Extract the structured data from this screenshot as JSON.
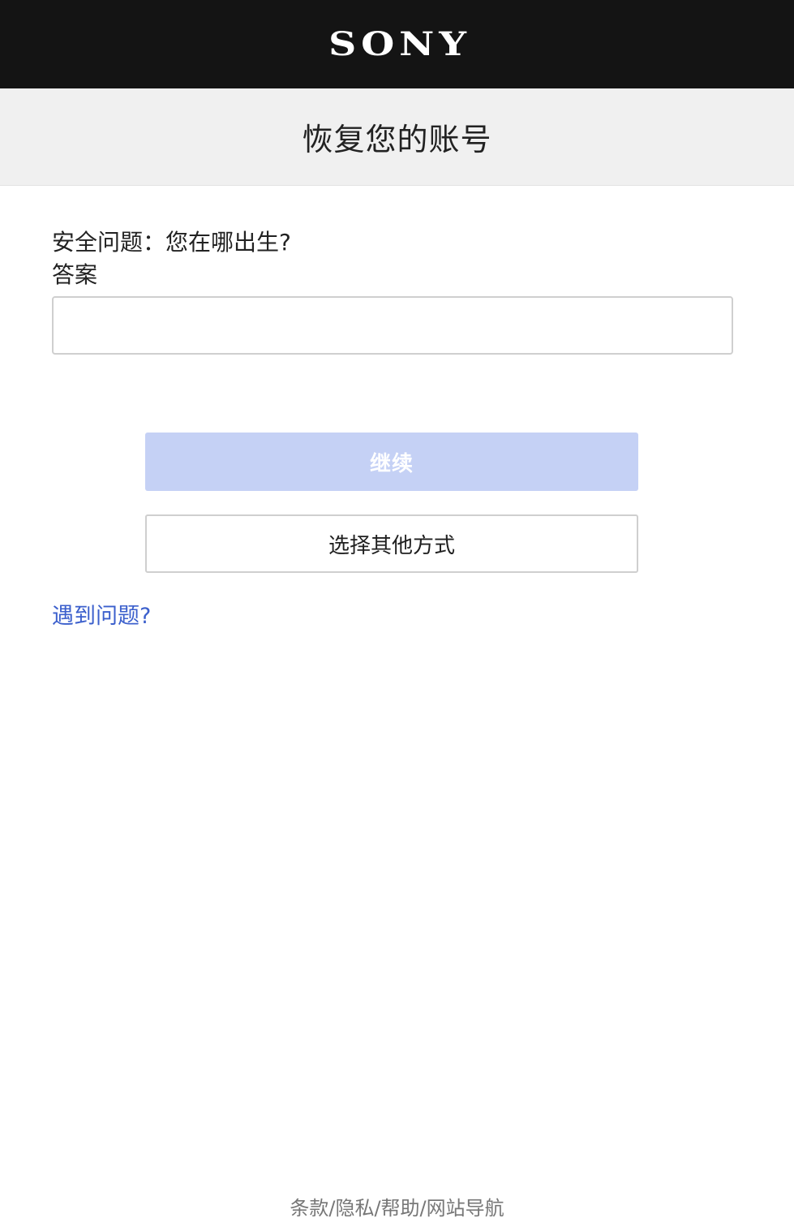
{
  "header": {
    "logo_text": "SONY"
  },
  "title_band": {
    "title": "恢复您的账号"
  },
  "form": {
    "question_text": "安全问题：您在哪出生?",
    "answer_label": "答案",
    "answer_value": "",
    "continue_label": "继续",
    "alt_method_label": "选择其他方式",
    "trouble_link": "遇到问题?"
  },
  "footer": {
    "links": [
      "条款",
      "隐私",
      "帮助",
      "网站导航"
    ],
    "separator": "/"
  },
  "colors": {
    "header_bg": "#141414",
    "title_band_bg": "#f0f0f0",
    "continue_button_disabled_bg": "#c5d1f5",
    "link_color": "#3b5fcc",
    "footer_text": "#777777"
  }
}
